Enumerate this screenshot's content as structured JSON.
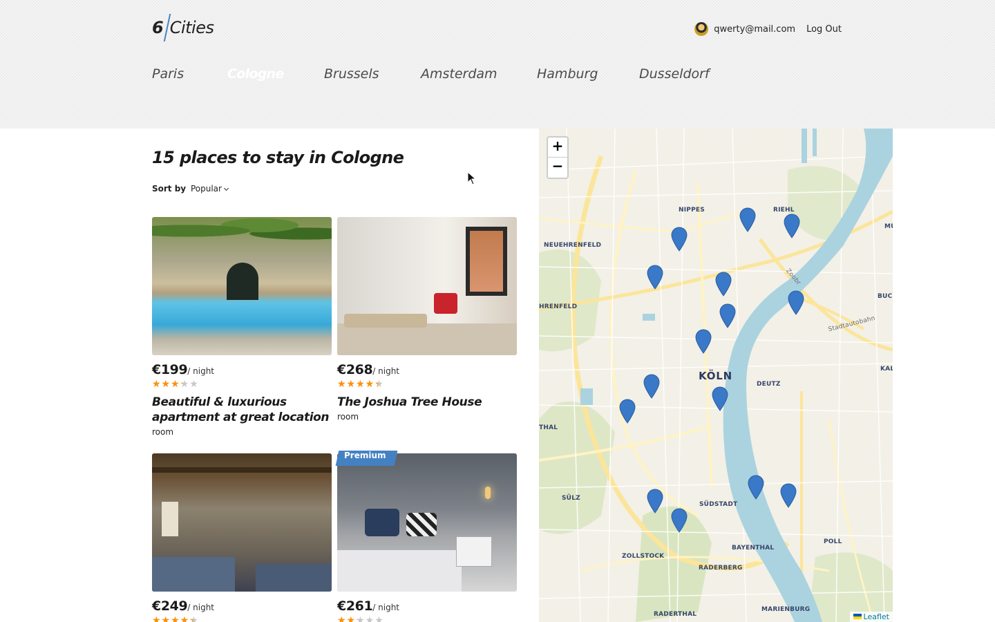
{
  "logo": {
    "number": "6",
    "word": "Cities"
  },
  "user": {
    "email": "qwerty@mail.com",
    "logout_label": "Log Out"
  },
  "tabs": [
    {
      "label": "Paris",
      "active": false
    },
    {
      "label": "Cologne",
      "active": true
    },
    {
      "label": "Brussels",
      "active": false
    },
    {
      "label": "Amsterdam",
      "active": false
    },
    {
      "label": "Hamburg",
      "active": false
    },
    {
      "label": "Dusseldorf",
      "active": false
    }
  ],
  "main": {
    "title": "15 places to stay in Cologne",
    "sort_label": "Sort by",
    "sort_value": "Popular"
  },
  "offers": [
    {
      "price": "€199",
      "per": "/ night",
      "rating": 3,
      "name": "Beautiful & luxurious apartment at great location",
      "type": "room",
      "premium": false
    },
    {
      "price": "€268",
      "per": "/ night",
      "rating": 4,
      "name": "The Joshua Tree House",
      "type": "room",
      "premium": false
    },
    {
      "price": "€249",
      "per": "/ night",
      "rating": 4,
      "name": "",
      "type": "",
      "premium": false
    },
    {
      "price": "€261",
      "per": "/ night",
      "rating": 2,
      "name": "",
      "type": "",
      "premium": true,
      "premium_label": "Premium"
    }
  ],
  "map": {
    "zoom_in": "+",
    "zoom_out": "−",
    "attribution": "Leaflet",
    "labels": {
      "koln": "KÖLN",
      "nippes": "NIPPES",
      "riehl": "RIEHL",
      "neuehrenfeld": "NEUEHRENFELD",
      "ehrenfeld": "HRENFELD",
      "deutz": "DEUTZ",
      "thal": "THAL",
      "sulz": "SÜLZ",
      "sudstadt": "SÜDSTADT",
      "zollstock": "ZOLLSTOCK",
      "bayenthal": "BAYENTHAL",
      "raderberg": "RADERBERG",
      "raderthal": "RADERTHAL",
      "marienburg": "MARIENBURG",
      "poll": "POLL",
      "buc": "BUC",
      "kal": "KAL",
      "mu": "MU",
      "zoobr": "Zoobr",
      "stadtautobahn": "Stadtautobahn"
    },
    "marker_color": "#3a78c8",
    "markers_count": 15
  },
  "colors": {
    "accent": "#4481c3",
    "star": "#ff9000",
    "star_off": "#c7c7c7"
  }
}
